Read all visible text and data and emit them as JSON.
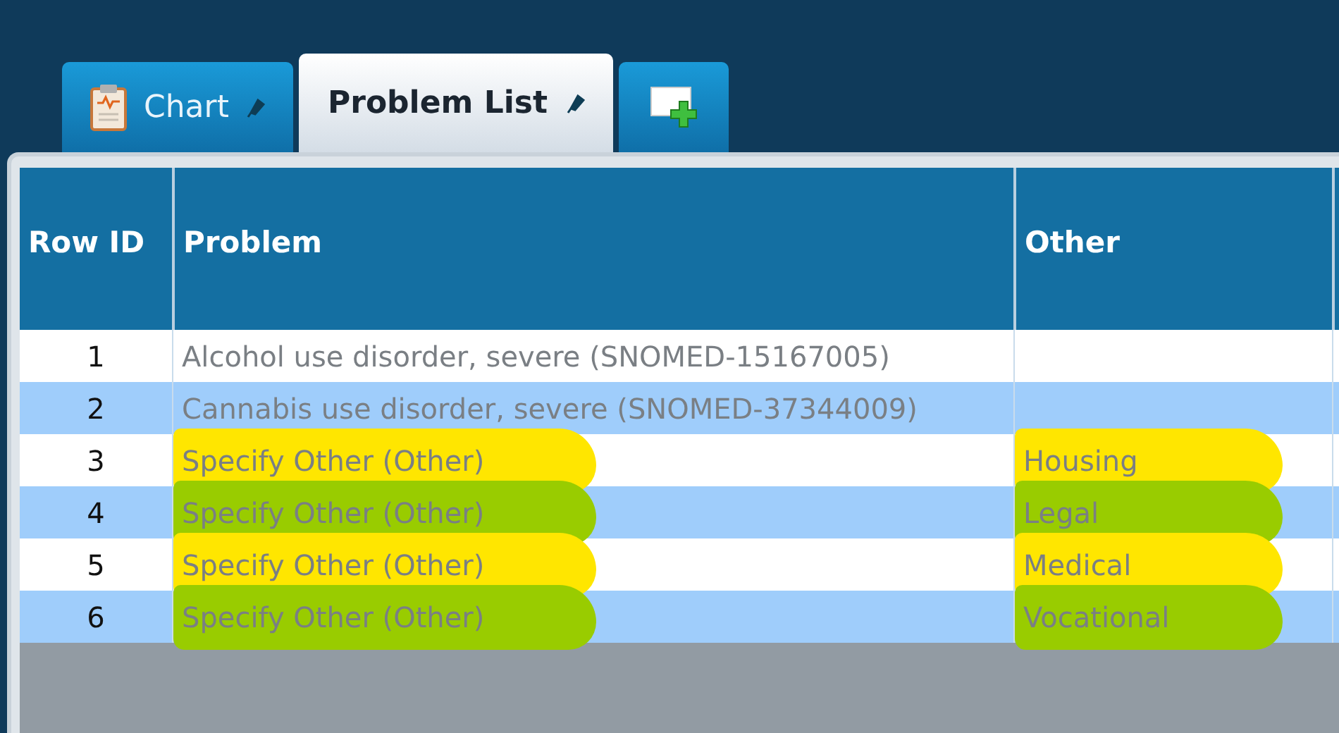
{
  "tabs": [
    {
      "label": "Chart",
      "kind": "chart",
      "selected": false
    },
    {
      "label": "Problem List",
      "kind": "text",
      "selected": true
    },
    {
      "kind": "add",
      "selected": false
    }
  ],
  "table": {
    "columns": [
      "Row ID",
      "Problem",
      "Other"
    ],
    "rows": [
      {
        "row_id": "1",
        "problem": "Alcohol use disorder, severe (SNOMED-15167005)"
      },
      {
        "row_id": "2",
        "problem": "Cannabis use disorder, severe (SNOMED-37344009)"
      },
      {
        "row_id": "3",
        "problem": "Specify Other (Other)",
        "other": "Housing",
        "color": "#ffe600"
      },
      {
        "row_id": "4",
        "problem": "Specify Other (Other)",
        "other": "Legal",
        "color": "#99cc00"
      },
      {
        "row_id": "5",
        "problem": "Specify Other (Other)",
        "other": "Medical",
        "color": "#ffe600"
      },
      {
        "row_id": "6",
        "problem": "Specify Other (Other)",
        "other": "Vocational",
        "color": "#99cc00"
      }
    ]
  }
}
